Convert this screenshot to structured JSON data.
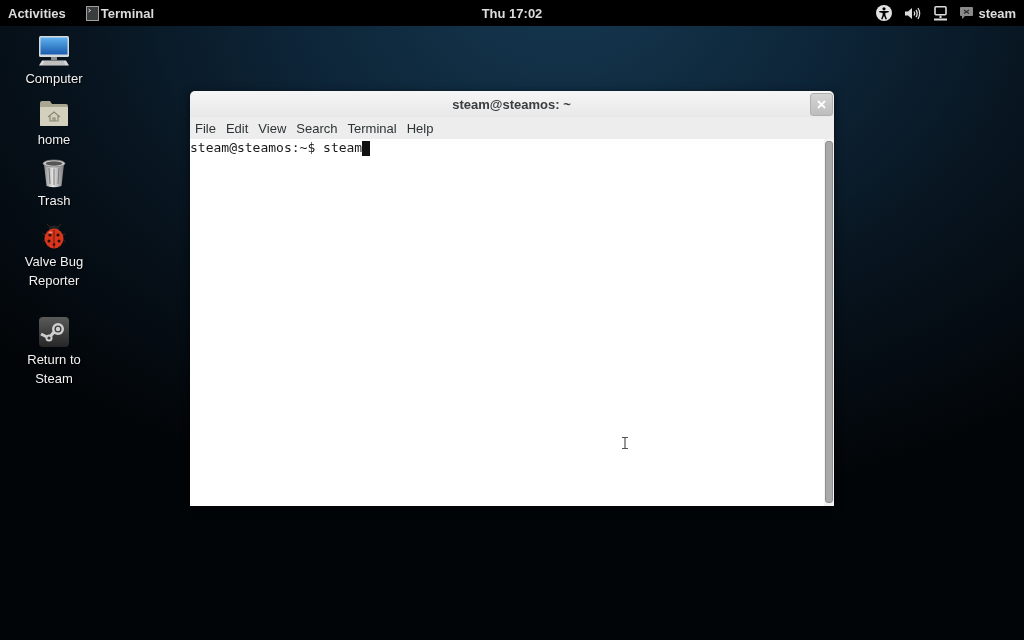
{
  "top_bar": {
    "activities": "Activities",
    "app_menu": "Terminal",
    "clock": "Thu 17:02",
    "user_menu": "steam"
  },
  "desktop_icons": [
    {
      "kind": "computer",
      "label": "Computer"
    },
    {
      "kind": "folder",
      "label": "home"
    },
    {
      "kind": "trash",
      "label": "Trash"
    },
    {
      "kind": "bug",
      "label": "Valve Bug Reporter"
    },
    {
      "kind": "steam",
      "label": "Return to Steam"
    }
  ],
  "terminal_window": {
    "title": "steam@steamos: ~",
    "menu": [
      "File",
      "Edit",
      "View",
      "Search",
      "Terminal",
      "Help"
    ],
    "lines": [
      "steam@steamos:~$ steam"
    ]
  }
}
